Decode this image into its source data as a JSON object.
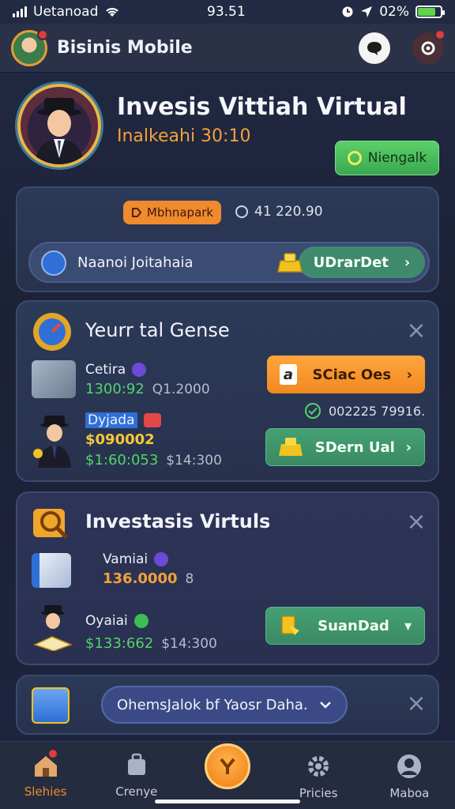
{
  "status_bar": {
    "carrier": "Uetanoad",
    "time": "93.51",
    "battery": "02%"
  },
  "header": {
    "app_title": "Bisinis Mobile"
  },
  "hero": {
    "title": "Invesis Vittiah Virtual",
    "subtitle": "Inalkeahi 30:10",
    "button_label": "Niengalk"
  },
  "summary_card": {
    "chip_label": "Mbhnapark",
    "balance": "41 220.90",
    "pill_text": "Naanoi Joitahaia",
    "pill_button": "UDrarDet"
  },
  "card1": {
    "title": "Yeurr tal Gense",
    "row1": {
      "label": "Cetira",
      "value": "1300:92",
      "secondary": "Q1.2000",
      "button": "SCiac Oes"
    },
    "check_text": "002225 79916.",
    "row2": {
      "label": "Dyjada",
      "value": "$090002",
      "value2": "$1:60:053",
      "secondary": "$14:300",
      "button": "SDern Ual"
    }
  },
  "card2": {
    "title": "Investasis Virtuls",
    "row1": {
      "label": "Vamiai",
      "value": "136.0000",
      "secondary": "8"
    },
    "row2": {
      "label": "Oyaiai",
      "value": "$133:662",
      "secondary": "$14:300",
      "button": "SuanDad"
    }
  },
  "card3": {
    "dropdown": "OhemsJalok bf Yaosr Daha."
  },
  "tabs": [
    {
      "label": "Slehies"
    },
    {
      "label": "Crenye"
    },
    {
      "label": ""
    },
    {
      "label": "Pricies"
    },
    {
      "label": "Maboa"
    }
  ],
  "colors": {
    "accent": "#f08a2e",
    "positive": "#52d46a",
    "panel": "#2b3a58"
  }
}
